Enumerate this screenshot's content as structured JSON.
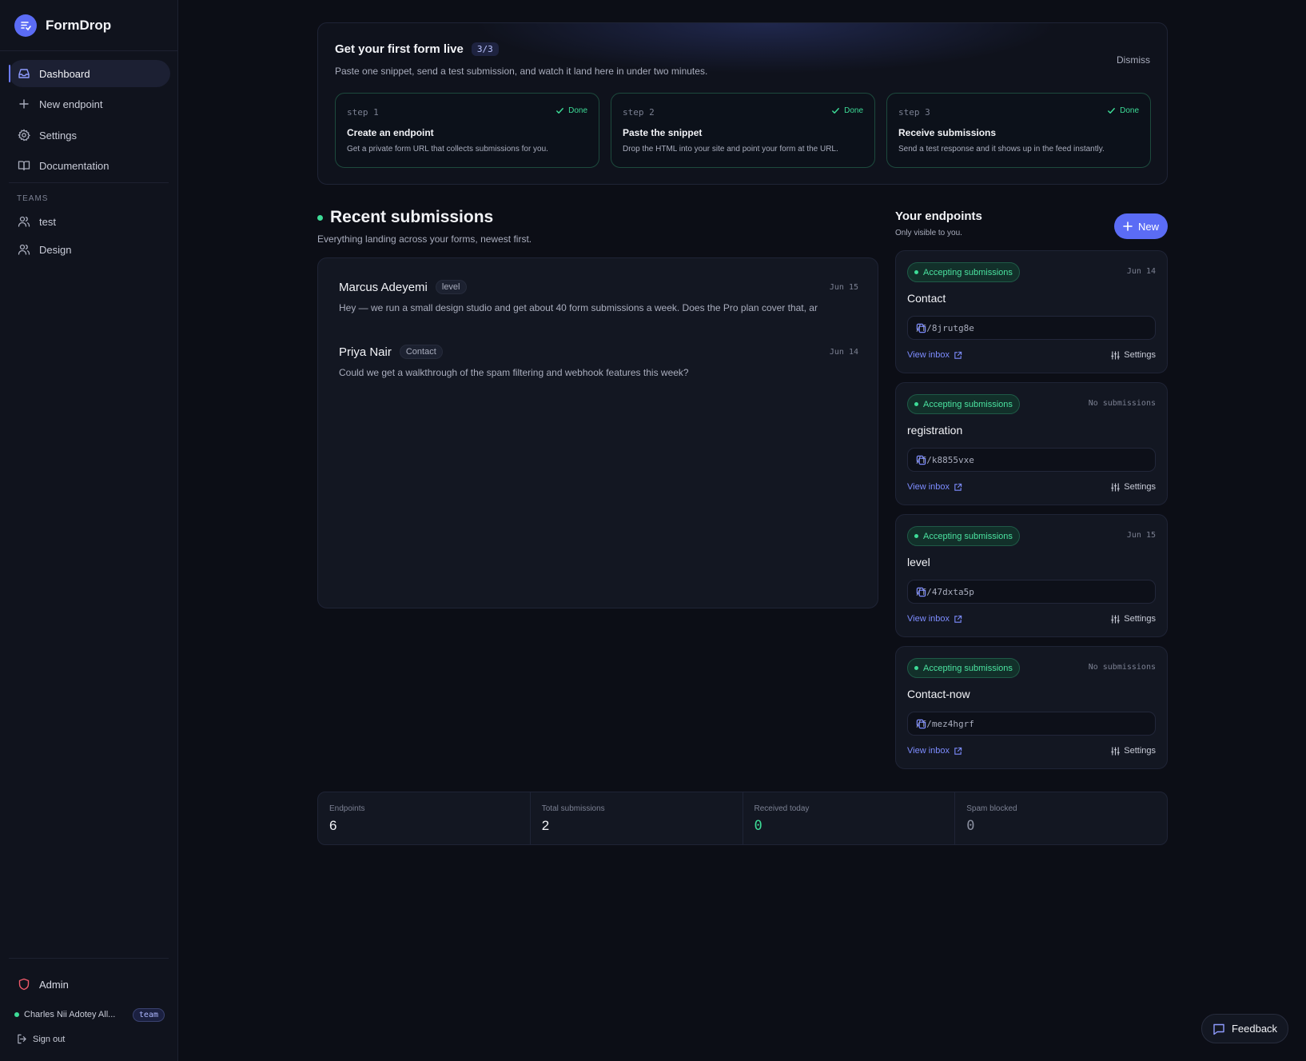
{
  "app": {
    "name": "FormDrop"
  },
  "sidebar": {
    "nav": [
      {
        "label": "Dashboard",
        "icon": "inbox-icon",
        "active": true
      },
      {
        "label": "New endpoint",
        "icon": "plus-icon"
      },
      {
        "label": "Settings",
        "icon": "gear-icon"
      },
      {
        "label": "Documentation",
        "icon": "book-icon"
      }
    ],
    "teams_heading": "TEAMS",
    "teams": [
      {
        "label": "test",
        "icon": "users-icon"
      },
      {
        "label": "Design",
        "icon": "users-icon"
      }
    ],
    "admin_label": "Admin",
    "user": {
      "name": "Charles Nii Adotey All...",
      "badge": "team"
    },
    "signout_label": "Sign out"
  },
  "onboarding": {
    "title": "Get your first form live",
    "progress": "3/3",
    "subtitle": "Paste one snippet, send a test submission, and watch it land here in under two minutes.",
    "dismiss_label": "Dismiss",
    "steps": [
      {
        "num": "step 1",
        "status": "Done",
        "title": "Create an endpoint",
        "desc": "Get a private form URL that collects submissions for you."
      },
      {
        "num": "step 2",
        "status": "Done",
        "title": "Paste the snippet",
        "desc": "Drop the HTML into your site and point your form at the URL."
      },
      {
        "num": "step 3",
        "status": "Done",
        "title": "Receive submissions",
        "desc": "Send a test response and it shows up in the feed instantly."
      }
    ]
  },
  "recent": {
    "title": "Recent submissions",
    "subtitle": "Everything landing across your forms, newest first.",
    "items": [
      {
        "name": "Marcus Adeyemi",
        "tag": "level",
        "date": "Jun 15",
        "message": "Hey — we run a small design studio and get about 40 form submissions a week. Does the Pro plan cover that, ar"
      },
      {
        "name": "Priya Nair",
        "tag": "Contact",
        "date": "Jun 14",
        "message": "Could we get a walkthrough of the spam filtering and webhook features this week?"
      }
    ]
  },
  "endpoints": {
    "title": "Your endpoints",
    "subtitle": "Only visible to you.",
    "new_label": "New",
    "view_label": "View inbox",
    "settings_label": "Settings",
    "items": [
      {
        "status": "Accepting submissions",
        "meta": "Jun 14",
        "name": "Contact",
        "url": "/f/8jrutg8e"
      },
      {
        "status": "Accepting submissions",
        "meta": "No submissions",
        "name": "registration",
        "url": "/f/k8855vxe"
      },
      {
        "status": "Accepting submissions",
        "meta": "Jun 15",
        "name": "level",
        "url": "/f/47dxta5p"
      },
      {
        "status": "Accepting submissions",
        "meta": "No submissions",
        "name": "Contact-now",
        "url": "/f/mez4hgrf"
      }
    ]
  },
  "stats": [
    {
      "label": "Endpoints",
      "value": "6"
    },
    {
      "label": "Total submissions",
      "value": "2"
    },
    {
      "label": "Received today",
      "value": "0"
    },
    {
      "label": "Spam blocked",
      "value": "0"
    }
  ],
  "feedback_label": "Feedback",
  "colors": {
    "accent": "#5b6cf5",
    "success": "#3ddc97",
    "link": "#7d8cff",
    "background": "#0c0e16"
  }
}
